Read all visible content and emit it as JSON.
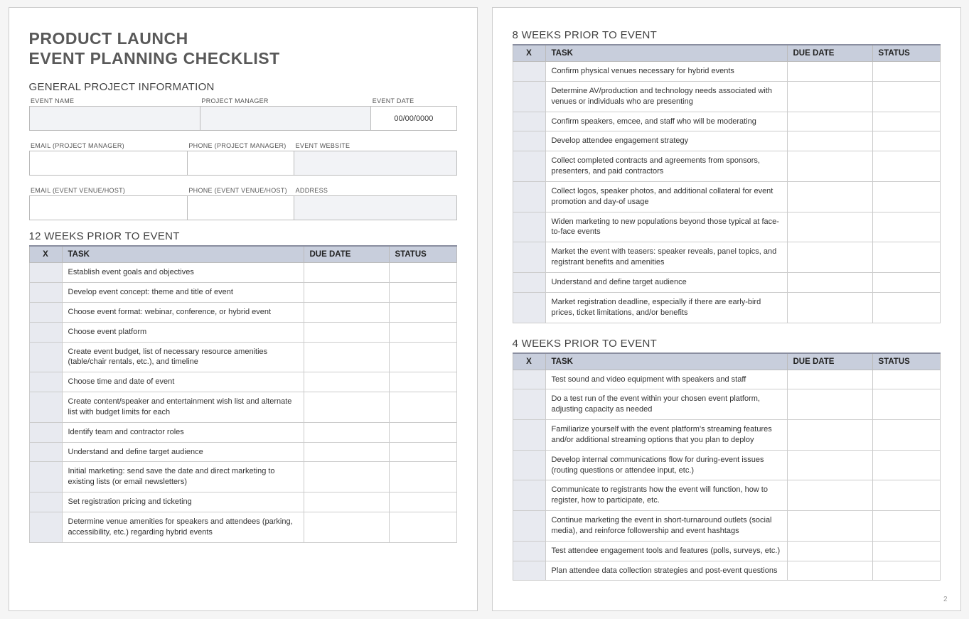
{
  "title_line1": "PRODUCT LAUNCH",
  "title_line2": "EVENT PLANNING CHECKLIST",
  "general_heading": "GENERAL PROJECT INFORMATION",
  "info_row1": {
    "labels": {
      "event_name": "EVENT NAME",
      "project_manager": "PROJECT MANAGER",
      "event_date": "EVENT DATE"
    },
    "values": {
      "event_name": "",
      "project_manager": "",
      "event_date": "00/00/0000"
    }
  },
  "info_row2": {
    "labels": {
      "email_pm": "EMAIL (PROJECT MANAGER)",
      "phone_pm": "PHONE (PROJECT MANAGER)",
      "website": "EVENT WEBSITE"
    },
    "values": {
      "email_pm": "",
      "phone_pm": "",
      "website": ""
    }
  },
  "info_row3": {
    "labels": {
      "email_venue": "EMAIL (EVENT VENUE/HOST)",
      "phone_venue": "PHONE (EVENT VENUE/HOST)",
      "address": "ADDRESS"
    },
    "values": {
      "email_venue": "",
      "phone_venue": "",
      "address": ""
    }
  },
  "columns": {
    "x": "X",
    "task": "TASK",
    "due": "DUE DATE",
    "status": "STATUS"
  },
  "sections": {
    "w12": {
      "heading": "12 WEEKS PRIOR TO EVENT",
      "tasks": [
        "Establish event goals and objectives",
        "Develop event concept: theme and title of event",
        "Choose event format: webinar, conference, or hybrid event",
        "Choose event platform",
        "Create event budget, list of necessary resource amenities (table/chair rentals, etc.), and timeline",
        "Choose time and date of event",
        "Create content/speaker and entertainment wish list and alternate list with budget limits for each",
        "Identify team and contractor roles",
        "Understand and define target audience",
        "Initial marketing: send save the date and direct marketing to existing lists (or email newsletters)",
        "Set registration pricing and ticketing",
        "Determine venue amenities for speakers and attendees (parking, accessibility, etc.) regarding hybrid events"
      ]
    },
    "w8": {
      "heading": "8 WEEKS PRIOR TO EVENT",
      "tasks": [
        "Confirm physical venues necessary for hybrid events",
        "Determine AV/production and technology needs associated with venues or individuals who are presenting",
        "Confirm speakers, emcee, and staff who will be moderating",
        "Develop attendee engagement strategy",
        "Collect completed contracts and agreements from sponsors, presenters, and paid contractors",
        "Collect logos, speaker photos, and additional collateral for event promotion and day-of usage",
        "Widen marketing to new populations beyond those typical at face-to-face events",
        "Market the event with teasers: speaker reveals, panel topics, and registrant benefits and amenities",
        "Understand and define target audience",
        "Market registration deadline, especially if there are early-bird prices, ticket limitations, and/or benefits"
      ]
    },
    "w4": {
      "heading": "4 WEEKS PRIOR TO EVENT",
      "tasks": [
        "Test sound and video equipment with speakers and staff",
        "Do a test run of the event within your chosen event platform, adjusting capacity as needed",
        "Familiarize yourself with the event platform's streaming features and/or additional streaming options that you plan to deploy",
        "Develop internal communications flow for during-event issues (routing questions or attendee input, etc.)",
        "Communicate to registrants how the event will function, how to register, how to participate, etc.",
        "Continue marketing the event in short-turnaround outlets (social media), and reinforce followership and event hashtags",
        "Test attendee engagement tools and features (polls, surveys, etc.)",
        "Plan attendee data collection strategies and post-event questions"
      ]
    }
  },
  "page_number": "2"
}
